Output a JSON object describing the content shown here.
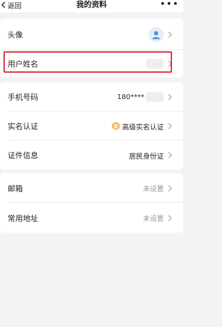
{
  "nav": {
    "back_label": "返回",
    "title": "我的资料",
    "more_label": "•••"
  },
  "profile_card": {
    "avatar_label": "头像",
    "name_label": "用户姓名"
  },
  "identity_card": {
    "phone_label": "手机号码",
    "phone_value": "180****",
    "realname_label": "实名认证",
    "realname_value": "高级实名认证",
    "cert_label": "证件信息",
    "cert_value": "居民身份证"
  },
  "contact_card": {
    "email_label": "邮箱",
    "email_value": "未设置",
    "address_label": "常用地址",
    "address_value": "未设置"
  },
  "colors": {
    "highlight": "#e0343a",
    "avatar": "#4a90e2",
    "badge": "#e8a33a"
  }
}
